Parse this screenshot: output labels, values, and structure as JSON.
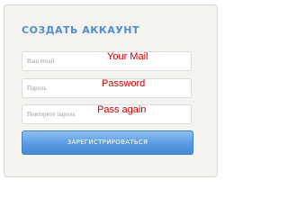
{
  "form": {
    "title": "СОЗДАТЬ АККАУНТ",
    "fields": [
      {
        "placeholder": "Ваш email",
        "overlay": "Your Mail"
      },
      {
        "placeholder": "Пароль",
        "overlay": "Password"
      },
      {
        "placeholder": "Повторите пароль",
        "overlay": "Pass again"
      }
    ],
    "submit_label": "ЗАРЕГИСТРИРОВАТЬСЯ"
  },
  "colors": {
    "accent": "#4f8fd0",
    "annotation": "#cc0000",
    "card_bg": "#f4f3ef"
  }
}
